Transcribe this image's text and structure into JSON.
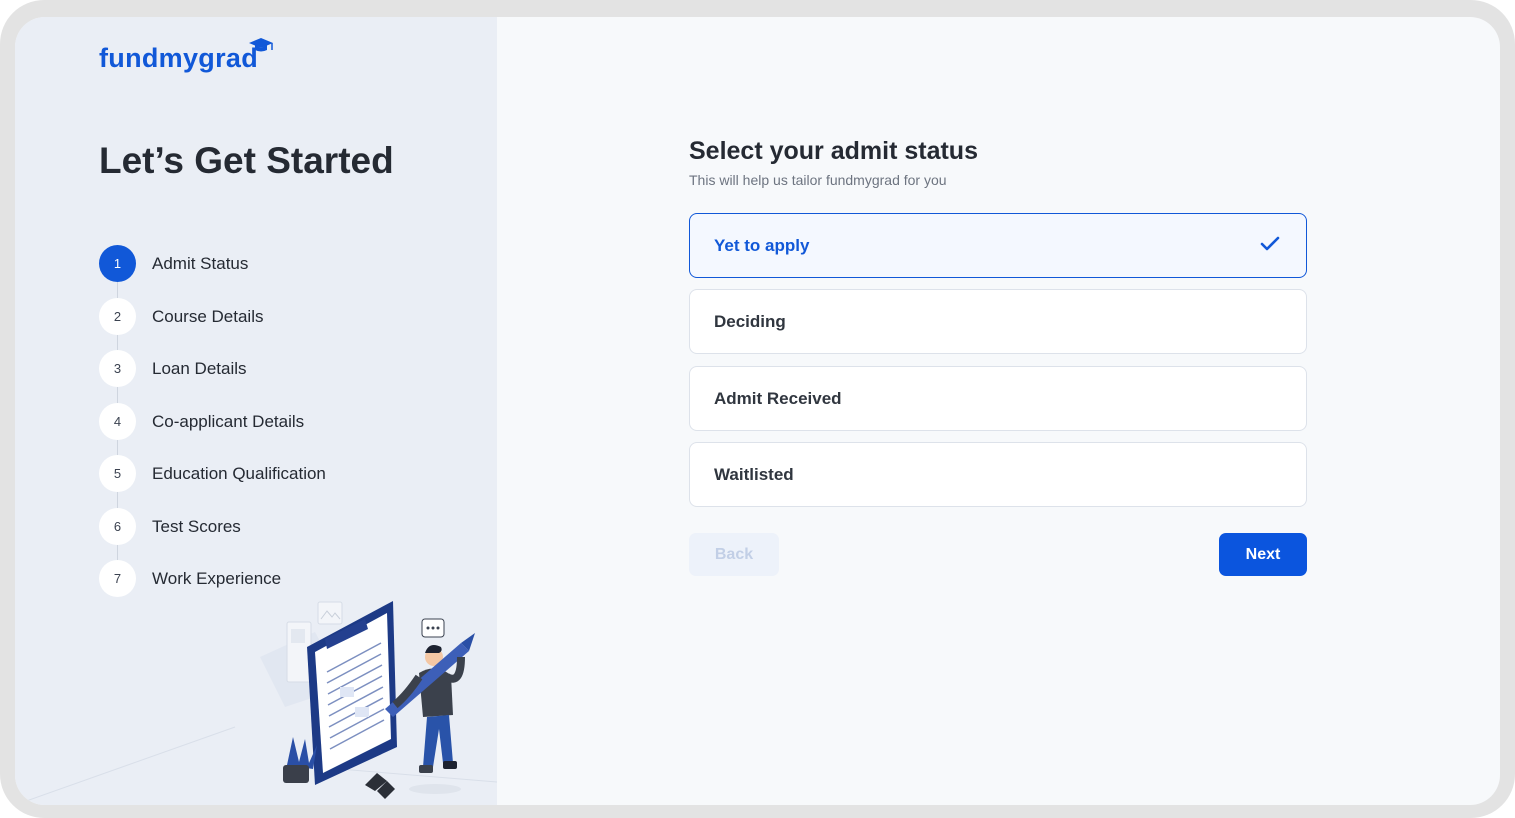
{
  "brand": {
    "name": "fundmygrad",
    "color": "#1158d8"
  },
  "sidebar": {
    "headline": "Let’s Get Started",
    "steps": [
      {
        "number": "1",
        "label": "Admit Status",
        "active": true
      },
      {
        "number": "2",
        "label": "Course Details",
        "active": false
      },
      {
        "number": "3",
        "label": "Loan Details",
        "active": false
      },
      {
        "number": "4",
        "label": "Co-applicant Details",
        "active": false
      },
      {
        "number": "5",
        "label": "Education Qualification",
        "active": false
      },
      {
        "number": "6",
        "label": "Test Scores",
        "active": false
      },
      {
        "number": "7",
        "label": "Work Experience",
        "active": false
      }
    ],
    "illustration": "person-filling-form-illustration"
  },
  "main": {
    "title": "Select your admit status",
    "subtitle": "This will help us tailor fundmygrad for you",
    "options": [
      {
        "label": "Yet to apply",
        "selected": true
      },
      {
        "label": "Deciding",
        "selected": false
      },
      {
        "label": "Admit Received",
        "selected": false
      },
      {
        "label": "Waitlisted",
        "selected": false
      }
    ],
    "back_label": "Back",
    "back_disabled": true,
    "next_label": "Next"
  },
  "colors": {
    "accent": "#1158d8",
    "next_button": "#0b55de",
    "sidebar_bg": "#eaeef5"
  }
}
